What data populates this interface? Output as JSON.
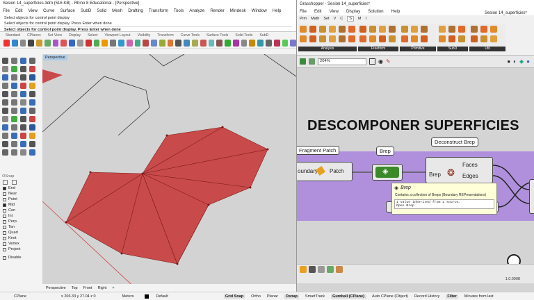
{
  "rhino": {
    "title": "Sesion 14_superficies.3dm (516 KB) - Rhino 8 Educational - [Perspective]",
    "menu": [
      "File",
      "Edit",
      "View",
      "Curve",
      "Surface",
      "SubD",
      "Solid",
      "Mesh",
      "Drafting",
      "Transform",
      "Tools",
      "Analyze",
      "Render",
      "Mindesk",
      "Window",
      "Help"
    ],
    "command_lines": [
      "Select objects for control point display",
      "Select objects for control point display. Press Enter when done",
      "Select objects for control point display. Press Enter when done"
    ],
    "toolbar_tabs": [
      "Standard",
      "CPlanes",
      "Set View",
      "Display",
      "Select",
      "Viewport Layout",
      "Visibility",
      "Transform",
      "Curve Tools",
      "Surface Tools",
      "Solid Tools",
      "SubD"
    ],
    "viewport_title": "Perspective",
    "viewport_tabs": [
      "Perspective",
      "Top",
      "Front",
      "Right",
      "+"
    ],
    "osnap": {
      "header": "OSnap",
      "items": [
        {
          "label": "End",
          "checked": true
        },
        {
          "label": "Near",
          "checked": false
        },
        {
          "label": "Point",
          "checked": false
        },
        {
          "label": "Mid",
          "checked": true
        },
        {
          "label": "Cen",
          "checked": false
        },
        {
          "label": "Int",
          "checked": false
        },
        {
          "label": "Perp",
          "checked": false
        },
        {
          "label": "Tan",
          "checked": false
        },
        {
          "label": "Quad",
          "checked": false
        },
        {
          "label": "Knot",
          "checked": false
        },
        {
          "label": "Vertex",
          "checked": false
        },
        {
          "label": "Project",
          "checked": false
        }
      ],
      "disable_label": "Disable"
    }
  },
  "status": {
    "cplane": "CPlane",
    "coords": "x 206.33  y 27.04  z 0",
    "units": "Meters",
    "layer": "Default",
    "toggles": [
      "Grid Snap",
      "Ortho",
      "Planar",
      "Osnap",
      "SmartTrack",
      "Gumball (CPlane)",
      "Auto CPlane (Object)",
      "Record History",
      "Filter",
      "Minutes from last"
    ]
  },
  "grasshopper": {
    "title": "Grasshopper - Sesion 14_superficies*",
    "menu": [
      "File",
      "Edit",
      "View",
      "Display",
      "Solution",
      "Help"
    ],
    "doc_name": "Sesion 14_superficies*",
    "tabs": [
      "Prm",
      "Math",
      "Set",
      "V",
      "C",
      "S",
      "M",
      "I"
    ],
    "selected_tab": "S",
    "ribbon_groups": [
      "Analysis",
      "Freeform",
      "Primitive",
      "SubD",
      "Util"
    ],
    "zoom": "204%",
    "heading": "DESCOMPONER SUPERFICIES",
    "components": {
      "fragment_patch": {
        "label": "Fragment Patch",
        "left_text": "oundary",
        "right_text": "Patch"
      },
      "brep": {
        "label": "Brep"
      },
      "deconstruct_brep": {
        "label": "Deconstruct Brep",
        "input": "Brep",
        "outputs": [
          "Faces",
          "Edges"
        ]
      }
    },
    "tooltip": {
      "title": "Brep",
      "description": "Contains a collection of Breps (Boundary REPresentations)",
      "line1": "1 value inherited from 1 source…",
      "line2": "Open Brep"
    },
    "version": "1.0.0008"
  },
  "colors": {
    "surface_fill": "#c94a4a",
    "group_purple": "#b090dd",
    "brep_green": "#3a8a2a"
  }
}
